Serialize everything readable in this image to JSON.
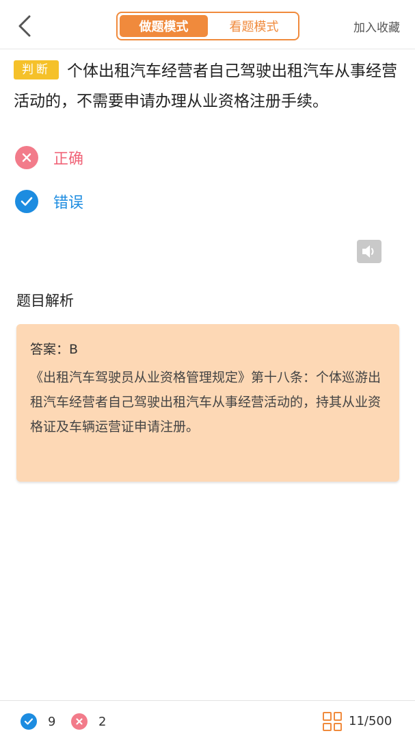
{
  "header": {
    "tab_practice": "做题模式",
    "tab_review": "看题模式",
    "collect": "加入收藏"
  },
  "question": {
    "tag": "判断",
    "text": "个体出租汽车经营者自己驾驶出租汽车从事经营活动的，不需要申请办理从业资格注册手续。"
  },
  "options": [
    {
      "label": "正确",
      "state": "wrong"
    },
    {
      "label": "错误",
      "state": "correct"
    }
  ],
  "analysis": {
    "title": "题目解析",
    "answer": "答案：B",
    "explanation": "《出租汽车驾驶员从业资格管理规定》第十八条：个体巡游出租汽车经营者自己驾驶出租汽车从事经营活动的，持其从业资格证及车辆运营证申请注册。"
  },
  "footer": {
    "correct_count": "9",
    "wrong_count": "2",
    "progress": "11/500"
  },
  "colors": {
    "accent": "#f08a3c",
    "correct": "#1d8ce0",
    "wrong": "#f27b8a",
    "tag": "#f5c12a",
    "analysis_bg": "#fdd8b5"
  }
}
